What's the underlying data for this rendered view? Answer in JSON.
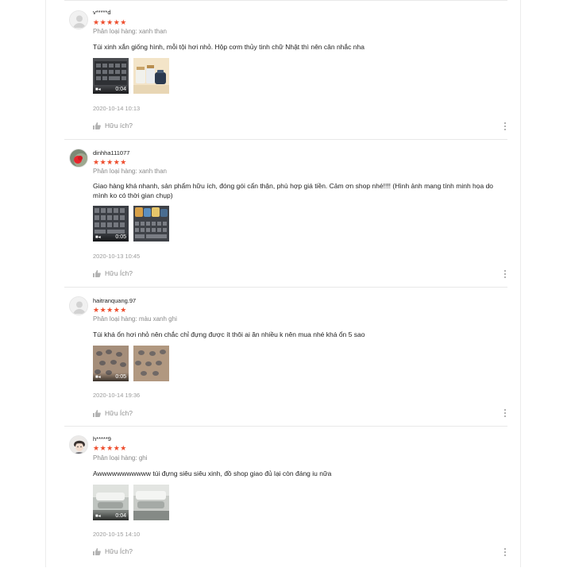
{
  "reviews": [
    {
      "username": "v*****d",
      "stars": "★★★★★",
      "variant": "Phân loại hàng: xanh than",
      "comment": "Túi xinh xắn giống hình, mỗi tội hơi nhỏ. Hộp cơm thủy tinh chữ Nhật thì nên cân nhắc nha",
      "video_duration": "0:04",
      "date": "2020-10-14 10:13",
      "helpful": "Hữu ích?"
    },
    {
      "username": "dinhha111077",
      "stars": "★★★★★",
      "variant": "Phân loại hàng: xanh than",
      "comment": "Giao hàng khá nhanh, sản phẩm hữu ích, đóng gói cẩn thận, phù hợp giá tiền. Cảm ơn shop nhé!!!! (Hình ảnh mang tính minh họa do mình ko có thời gian chụp)",
      "video_duration": "0:05",
      "date": "2020-10-13 10:45",
      "helpful": "Hữu Ích?"
    },
    {
      "username": "haitranquang.97",
      "stars": "★★★★★",
      "variant": "Phân loại hàng: màu xanh ghi",
      "comment": "Túi khá ổn hơi nhỏ nên chắc chỉ đựng được ít thôi ai ăn nhiều k nên mua nhé khá ổn 5 sao",
      "video_duration": "0:05",
      "date": "2020-10-14 19:36",
      "helpful": "Hữu Ích?"
    },
    {
      "username": "h*****9",
      "stars": "★★★★★",
      "variant": "Phân loại hàng: ghi",
      "comment": "Awwwwwwwwwww túi đựng siêu siêu xinh, đồ shop giao đủ lại còn đáng iu nữa",
      "video_duration": "0:04",
      "date": "2020-10-15 14:10",
      "helpful": "Hữu Ích?"
    }
  ],
  "icons": {
    "avatar_default": "user-silhouette-icon",
    "video": "video-camera-icon",
    "like": "thumbs-up-icon",
    "more": "more-vertical-icon"
  },
  "colors": {
    "star": "#ee4d2d",
    "muted_text": "#8a8a8a",
    "divider": "#e8e8e8"
  }
}
